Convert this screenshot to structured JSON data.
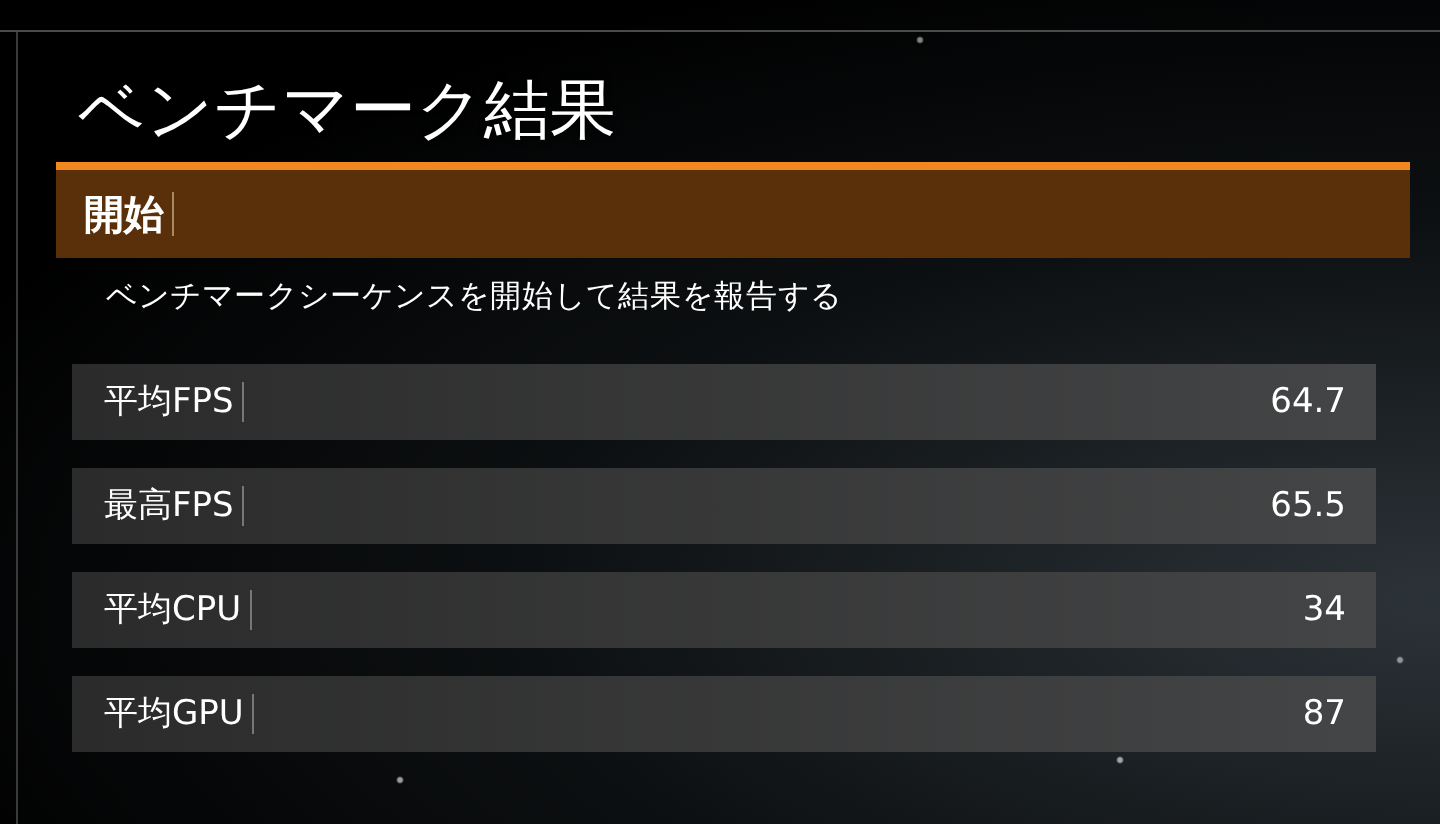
{
  "title": "ベンチマーク結果",
  "actions": [
    {
      "label": "開始",
      "selected": true,
      "description": "ベンチマークシーケンスを開始して結果を報告する"
    }
  ],
  "results": [
    {
      "label": "平均FPS",
      "value": "64.7"
    },
    {
      "label": "最高FPS",
      "value": "65.5"
    },
    {
      "label": "平均CPU",
      "value": "34"
    },
    {
      "label": "平均GPU",
      "value": "87"
    }
  ]
}
